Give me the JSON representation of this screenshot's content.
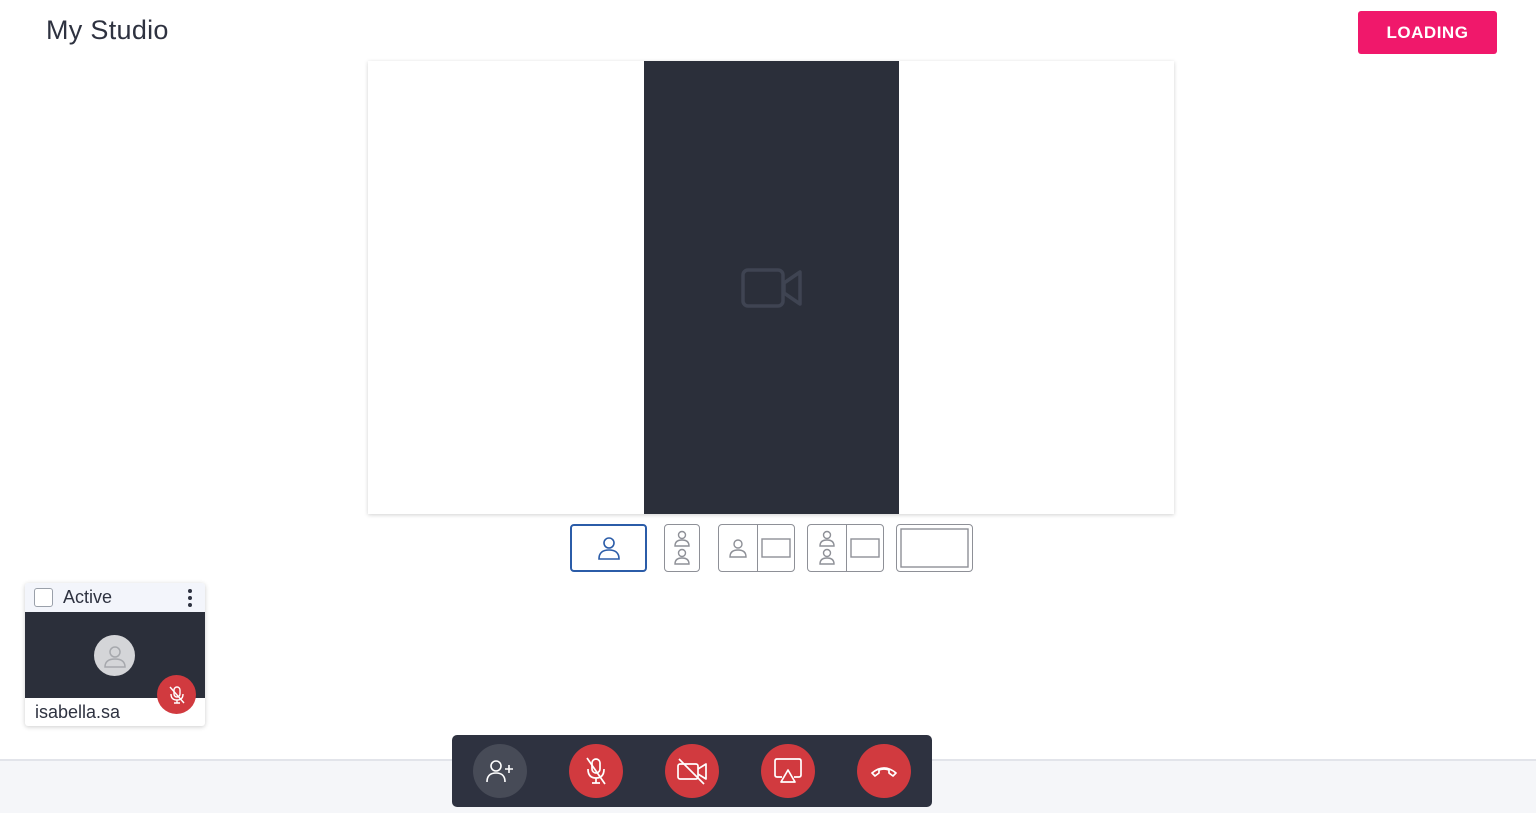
{
  "header": {
    "title": "My Studio",
    "status_button_label": "LOADING"
  },
  "stage": {
    "video_placeholder_icon": "video-camera-icon"
  },
  "layout_options": [
    {
      "name": "single-person",
      "selected": true
    },
    {
      "name": "two-people-stacked",
      "selected": false
    },
    {
      "name": "person-with-screen",
      "selected": false
    },
    {
      "name": "two-people-with-screen",
      "selected": false
    },
    {
      "name": "screen-only",
      "selected": false
    }
  ],
  "participant": {
    "status_label": "Active",
    "checked": false,
    "name": "isabella.sa",
    "muted": true,
    "icons": [
      "kebab-menu-icon",
      "person-icon",
      "mic-off-icon"
    ]
  },
  "controls": [
    {
      "name": "add-participant",
      "icon": "person-add-icon"
    },
    {
      "name": "mute-mic",
      "icon": "mic-off-icon"
    },
    {
      "name": "camera-off",
      "icon": "video-off-icon"
    },
    {
      "name": "share-screen",
      "icon": "screen-share-icon"
    },
    {
      "name": "end-call",
      "icon": "phone-hangup-icon"
    }
  ],
  "colors": {
    "accent": "#f0186b",
    "danger": "#d13a3f",
    "selected_layout": "#2b5ca8",
    "dark_panel": "#2b2f3a"
  }
}
